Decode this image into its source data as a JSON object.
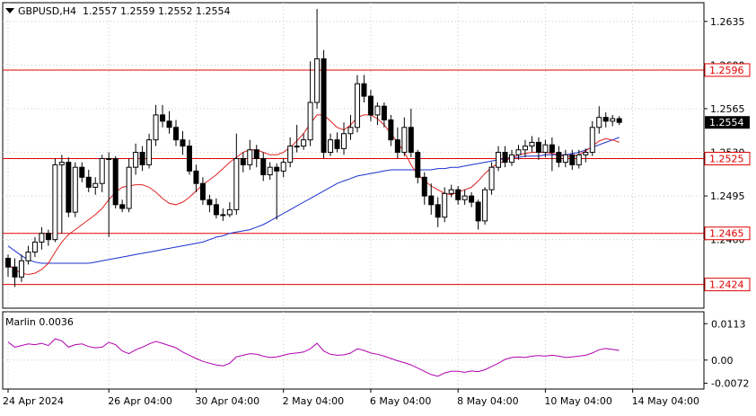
{
  "header": {
    "symbol_timeframe": "GBPUSD,H4",
    "ohlc": "1.2557 1.2559 1.2552 1.2554"
  },
  "indicator": {
    "label": "Marlin 0.0036",
    "ticks": [
      "0.0113",
      "0.00",
      "-0.0072"
    ]
  },
  "colors": {
    "background": "#ffffff",
    "plot_bg": "#ffffff",
    "grid": "#c8c8c8",
    "candle": "#000000",
    "ma_fast": "#e02020",
    "ma_slow": "#1a2fd0",
    "marlin": "#b000b0",
    "level": "#e00000"
  },
  "chart_data": [
    {
      "type": "candlestick",
      "title": "GBPUSD,H4",
      "x_labels": [
        "24 Apr 2024",
        "26 Apr 04:00",
        "30 Apr 04:00",
        "2 May 04:00",
        "6 May 04:00",
        "8 May 04:00",
        "10 May 04:00",
        "14 May 04:00"
      ],
      "ylim": [
        1.2405,
        1.265
      ],
      "y_ticks": [
        1.2635,
        1.26,
        1.2565,
        1.253,
        1.2495,
        1.246
      ],
      "price_labels": [
        "1.2635",
        "1.2600",
        "1.2565",
        "1.2530",
        "1.2495",
        "1.2460"
      ],
      "levels": [
        {
          "value": 1.2596,
          "label": "1.2596"
        },
        {
          "value": 1.2525,
          "label": "1.2525"
        },
        {
          "value": 1.2465,
          "label": "1.2465"
        },
        {
          "value": 1.2424,
          "label": "1.2424"
        }
      ],
      "current_price": {
        "value": 1.2554,
        "label": "1.2554"
      },
      "grid": true,
      "candles": [
        [
          1.2445,
          1.2438,
          1.2448,
          1.243
        ],
        [
          1.2438,
          1.243,
          1.2445,
          1.2422
        ],
        [
          1.243,
          1.2443,
          1.2448,
          1.2426
        ],
        [
          1.2443,
          1.245,
          1.2455,
          1.244
        ],
        [
          1.245,
          1.2458,
          1.2462,
          1.2446
        ],
        [
          1.2458,
          1.2465,
          1.247,
          1.2452
        ],
        [
          1.2465,
          1.246,
          1.2468,
          1.2455
        ],
        [
          1.246,
          1.252,
          1.2525,
          1.2458
        ],
        [
          1.252,
          1.2522,
          1.2528,
          1.2465
        ],
        [
          1.2522,
          1.2482,
          1.2526,
          1.2478
        ],
        [
          1.2482,
          1.2518,
          1.2522,
          1.2478
        ],
        [
          1.2518,
          1.251,
          1.2522,
          1.2506
        ],
        [
          1.251,
          1.2502,
          1.2516,
          1.2498
        ],
        [
          1.2502,
          1.2505,
          1.251,
          1.2496
        ],
        [
          1.2505,
          1.2525,
          1.2528,
          1.2498
        ],
        [
          1.2525,
          1.2525,
          1.253,
          1.2462
        ],
        [
          1.2525,
          1.2488,
          1.2527,
          1.2485
        ],
        [
          1.2488,
          1.2485,
          1.2492,
          1.2482
        ],
        [
          1.2485,
          1.2518,
          1.2525,
          1.2482
        ],
        [
          1.2518,
          1.253,
          1.2537,
          1.2512
        ],
        [
          1.253,
          1.252,
          1.2535,
          1.2515
        ],
        [
          1.252,
          1.254,
          1.2545,
          1.2517
        ],
        [
          1.254,
          1.256,
          1.2568,
          1.2535
        ],
        [
          1.256,
          1.2555,
          1.2568,
          1.255
        ],
        [
          1.2555,
          1.255,
          1.2563,
          1.2545
        ],
        [
          1.255,
          1.254,
          1.2556,
          1.2535
        ],
        [
          1.254,
          1.2535,
          1.2547,
          1.2528
        ],
        [
          1.2535,
          1.2515,
          1.254,
          1.2512
        ],
        [
          1.2515,
          1.2505,
          1.252,
          1.2498
        ],
        [
          1.2505,
          1.2492,
          1.251,
          1.2488
        ],
        [
          1.2492,
          1.2488,
          1.2496,
          1.2482
        ],
        [
          1.2488,
          1.248,
          1.2493,
          1.2477
        ],
        [
          1.248,
          1.248,
          1.2485,
          1.2475
        ],
        [
          1.248,
          1.2484,
          1.249,
          1.2478
        ],
        [
          1.2484,
          1.2525,
          1.2545,
          1.248
        ],
        [
          1.2525,
          1.252,
          1.253,
          1.2514
        ],
        [
          1.252,
          1.2532,
          1.254,
          1.2516
        ],
        [
          1.2532,
          1.2525,
          1.2536,
          1.2518
        ],
        [
          1.2525,
          1.2512,
          1.253,
          1.2507
        ],
        [
          1.2512,
          1.2518,
          1.2522,
          1.2508
        ],
        [
          1.2518,
          1.2515,
          1.2521,
          1.2476
        ],
        [
          1.2515,
          1.2522,
          1.2525,
          1.251
        ],
        [
          1.2522,
          1.2535,
          1.2542,
          1.2518
        ],
        [
          1.2535,
          1.2535,
          1.2552,
          1.253
        ],
        [
          1.2535,
          1.254,
          1.2545,
          1.2532
        ],
        [
          1.254,
          1.257,
          1.2603,
          1.2535
        ],
        [
          1.257,
          1.2605,
          1.2645,
          1.2565
        ],
        [
          1.2605,
          1.253,
          1.2612,
          1.2525
        ],
        [
          1.253,
          1.254,
          1.2545,
          1.2527
        ],
        [
          1.254,
          1.2533,
          1.2546,
          1.253
        ],
        [
          1.2533,
          1.2545,
          1.2554,
          1.2528
        ],
        [
          1.2545,
          1.255,
          1.256,
          1.254
        ],
        [
          1.255,
          1.2585,
          1.2592,
          1.2546
        ],
        [
          1.2585,
          1.2575,
          1.2592,
          1.257
        ],
        [
          1.2575,
          1.256,
          1.258,
          1.2555
        ],
        [
          1.256,
          1.2567,
          1.257,
          1.2552
        ],
        [
          1.2567,
          1.2556,
          1.257,
          1.255
        ],
        [
          1.2556,
          1.254,
          1.256,
          1.2535
        ],
        [
          1.254,
          1.253,
          1.255,
          1.2525
        ],
        [
          1.253,
          1.255,
          1.2558,
          1.2527
        ],
        [
          1.255,
          1.253,
          1.2565,
          1.2526
        ],
        [
          1.253,
          1.251,
          1.2532,
          1.2505
        ],
        [
          1.251,
          1.2495,
          1.2514,
          1.2488
        ],
        [
          1.2495,
          1.2488,
          1.2505,
          1.248
        ],
        [
          1.2488,
          1.2478,
          1.2494,
          1.247
        ],
        [
          1.2478,
          1.2497,
          1.2502,
          1.2474
        ],
        [
          1.2497,
          1.25,
          1.2504,
          1.2494
        ],
        [
          1.25,
          1.2492,
          1.2503,
          1.2488
        ],
        [
          1.2492,
          1.2495,
          1.25,
          1.2488
        ],
        [
          1.2495,
          1.249,
          1.2498,
          1.2486
        ],
        [
          1.249,
          1.2475,
          1.2492,
          1.2468
        ],
        [
          1.2475,
          1.25,
          1.2502,
          1.2472
        ],
        [
          1.25,
          1.2518,
          1.2522,
          1.2496
        ],
        [
          1.2518,
          1.253,
          1.2535,
          1.2515
        ],
        [
          1.253,
          1.2522,
          1.2535,
          1.2518
        ],
        [
          1.2522,
          1.2528,
          1.2532,
          1.2519
        ],
        [
          1.2528,
          1.2532,
          1.2536,
          1.2524
        ],
        [
          1.2532,
          1.2535,
          1.254,
          1.2526
        ],
        [
          1.2535,
          1.2538,
          1.2543,
          1.253
        ],
        [
          1.2538,
          1.253,
          1.2542,
          1.2524
        ],
        [
          1.253,
          1.2536,
          1.254,
          1.2526
        ],
        [
          1.2536,
          1.253,
          1.2542,
          1.2515
        ],
        [
          1.253,
          1.2522,
          1.2535,
          1.2518
        ],
        [
          1.2522,
          1.2528,
          1.2532,
          1.2518
        ],
        [
          1.2528,
          1.252,
          1.2532,
          1.2516
        ],
        [
          1.252,
          1.2528,
          1.2532,
          1.2517
        ],
        [
          1.2528,
          1.253,
          1.2533,
          1.2522
        ],
        [
          1.253,
          1.255,
          1.2555,
          1.2527
        ],
        [
          1.255,
          1.2558,
          1.2567,
          1.2545
        ],
        [
          1.2558,
          1.2555,
          1.2562,
          1.255
        ],
        [
          1.2555,
          1.2557,
          1.256,
          1.2551
        ],
        [
          1.2557,
          1.2554,
          1.2559,
          1.2552
        ]
      ],
      "ma_fast": [
        1.244,
        1.2436,
        1.2433,
        1.2432,
        1.2433,
        1.2436,
        1.2441,
        1.245,
        1.2458,
        1.2464,
        1.2468,
        1.2472,
        1.2476,
        1.248,
        1.2485,
        1.2492,
        1.2498,
        1.2502,
        1.2503,
        1.2504,
        1.2504,
        1.2502,
        1.2498,
        1.2493,
        1.2489,
        1.2488,
        1.249,
        1.2494,
        1.2499,
        1.2504,
        1.2508,
        1.2512,
        1.2517,
        1.2522,
        1.2526,
        1.253,
        1.2532,
        1.2532,
        1.253,
        1.2528,
        1.2528,
        1.253,
        1.2534,
        1.2539,
        1.2545,
        1.2553,
        1.256,
        1.256,
        1.2555,
        1.255,
        1.2548,
        1.2552,
        1.2558,
        1.256,
        1.256,
        1.2557,
        1.2552,
        1.2545,
        1.2538,
        1.253,
        1.252,
        1.2512,
        1.2507,
        1.2503,
        1.25,
        1.2497,
        1.2496,
        1.2498,
        1.25,
        1.2502,
        1.2507,
        1.2513,
        1.2518,
        1.2521,
        1.2523,
        1.2526,
        1.2528,
        1.2529,
        1.253,
        1.253,
        1.253,
        1.2529,
        1.2528,
        1.2527,
        1.2527,
        1.2528,
        1.2531,
        1.2535,
        1.2539,
        1.2541,
        1.254,
        1.2538
      ],
      "ma_slow": [
        1.2455,
        1.2451,
        1.2447,
        1.2444,
        1.2442,
        1.2441,
        1.2441,
        1.2441,
        1.2441,
        1.2441,
        1.2441,
        1.2441,
        1.2441,
        1.2442,
        1.2443,
        1.2444,
        1.2445,
        1.2446,
        1.2447,
        1.2448,
        1.2449,
        1.245,
        1.2451,
        1.2452,
        1.2453,
        1.2454,
        1.2455,
        1.2456,
        1.2457,
        1.2458,
        1.246,
        1.2462,
        1.2463,
        1.2465,
        1.2466,
        1.2467,
        1.2468,
        1.247,
        1.2472,
        1.2475,
        1.2478,
        1.2481,
        1.2484,
        1.2487,
        1.249,
        1.2493,
        1.2496,
        1.2499,
        1.2502,
        1.2505,
        1.2507,
        1.2509,
        1.2511,
        1.2512,
        1.2513,
        1.2514,
        1.2515,
        1.2516,
        1.2516,
        1.2516,
        1.2516,
        1.2516,
        1.2516,
        1.2516,
        1.2517,
        1.2517,
        1.2518,
        1.2518,
        1.2519,
        1.252,
        1.2521,
        1.2522,
        1.2523,
        1.2524,
        1.2525,
        1.2526,
        1.2526,
        1.2527,
        1.2527,
        1.2527,
        1.2528,
        1.2528,
        1.2528,
        1.2528,
        1.2529,
        1.253,
        1.2532,
        1.2534,
        1.2536,
        1.2538,
        1.254,
        1.2542
      ]
    },
    {
      "type": "line",
      "title": "Marlin 0.0036",
      "ylim": [
        -0.009,
        0.015
      ],
      "y_ticks": [
        0.0113,
        0.0,
        -0.0072
      ],
      "values": [
        0.0056,
        0.004,
        0.0045,
        0.005,
        0.0048,
        0.0052,
        0.0045,
        0.0066,
        0.006,
        0.004,
        0.0048,
        0.005,
        0.0042,
        0.0038,
        0.004,
        0.0055,
        0.0048,
        0.0028,
        0.002,
        0.0032,
        0.004,
        0.005,
        0.0058,
        0.0052,
        0.0045,
        0.0038,
        0.0025,
        0.0015,
        0.0005,
        -0.0004,
        -0.001,
        -0.0015,
        -0.0018,
        -0.001,
        0.001,
        0.0015,
        0.002,
        0.0018,
        0.0012,
        0.0008,
        0.001,
        0.0015,
        0.002,
        0.0022,
        0.0025,
        0.0035,
        0.0052,
        0.0028,
        0.0018,
        0.0015,
        0.0016,
        0.0022,
        0.0035,
        0.003,
        0.0022,
        0.0018,
        0.0012,
        0.0005,
        -0.0002,
        -0.0008,
        -0.0015,
        -0.0025,
        -0.0035,
        -0.0045,
        -0.005,
        -0.004,
        -0.0035,
        -0.0035,
        -0.0038,
        -0.0034,
        -0.0036,
        -0.003,
        -0.002,
        -0.001,
        0.0002,
        0.0008,
        0.001,
        0.0008,
        0.0012,
        0.0014,
        0.0012,
        0.0015,
        0.0012,
        0.0008,
        0.001,
        0.0012,
        0.0015,
        0.0022,
        0.0032,
        0.0036,
        0.0033,
        0.003
      ]
    }
  ]
}
